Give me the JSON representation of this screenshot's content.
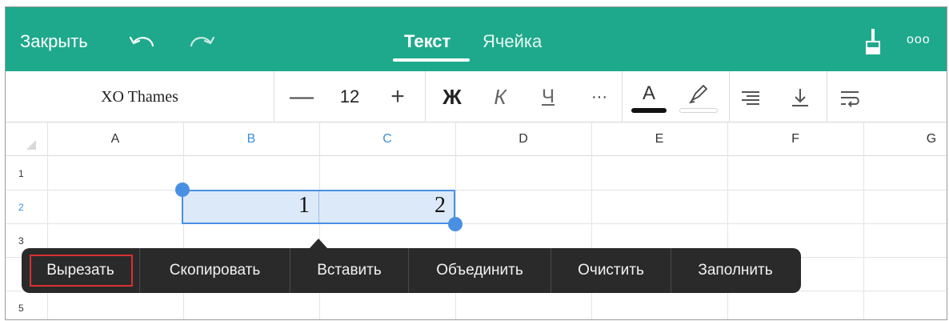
{
  "topbar": {
    "close_label": "Закрыть",
    "tabs": [
      {
        "label": "Текст",
        "active": true
      },
      {
        "label": "Ячейка",
        "active": false
      }
    ],
    "more_label": "ooo",
    "accent_color": "#1fa98c"
  },
  "toolbar": {
    "font_name": "XO Thames",
    "font_size": "12",
    "minus_label": "—",
    "plus_label": "+",
    "bold_label": "Ж",
    "italic_label": "К",
    "underline_label": "Ч",
    "more_label": "···",
    "text_color_label": "A"
  },
  "grid": {
    "columns": [
      "A",
      "B",
      "C",
      "D",
      "E",
      "F",
      "G"
    ],
    "selected_columns": [
      "B",
      "C"
    ],
    "rows": [
      "1",
      "2",
      "3",
      "5"
    ],
    "selected_row": "2",
    "cells": {
      "B2": "1",
      "C2": "2"
    },
    "selection_color": "#4a90e2"
  },
  "context_menu": {
    "items": [
      {
        "label": "Вырезать",
        "highlighted": true
      },
      {
        "label": "Скопировать",
        "highlighted": false
      },
      {
        "label": "Вставить",
        "highlighted": false
      },
      {
        "label": "Объединить",
        "highlighted": false
      },
      {
        "label": "Очистить",
        "highlighted": false
      },
      {
        "label": "Заполнить",
        "highlighted": false
      }
    ]
  }
}
